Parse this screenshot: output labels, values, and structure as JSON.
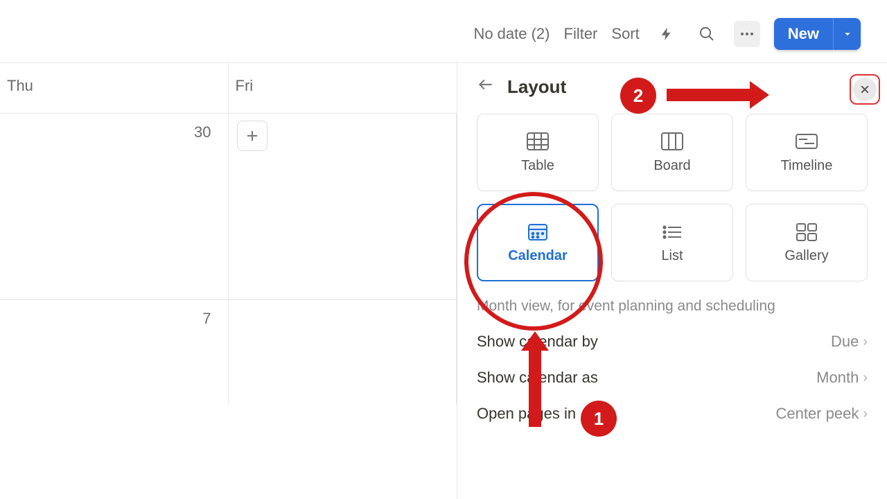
{
  "toolbar": {
    "no_date": "No date (2)",
    "filter": "Filter",
    "sort": "Sort",
    "new_label": "New"
  },
  "calendar": {
    "thu": "Thu",
    "fri": "Fri",
    "d30": "30",
    "d7": "7"
  },
  "panel": {
    "title": "Layout",
    "layouts": {
      "table": "Table",
      "board": "Board",
      "timeline": "Timeline",
      "calendar": "Calendar",
      "list": "List",
      "gallery": "Gallery",
      "selected": "calendar"
    },
    "description": "Month view, for event planning and scheduling",
    "settings": {
      "show_by_label": "Show calendar by",
      "show_by_value": "Due",
      "show_as_label": "Show calendar as",
      "show_as_value": "Month",
      "open_in_label": "Open pages in",
      "open_in_value": "Center peek"
    }
  },
  "annotations": {
    "badge1": "1",
    "badge2": "2"
  }
}
